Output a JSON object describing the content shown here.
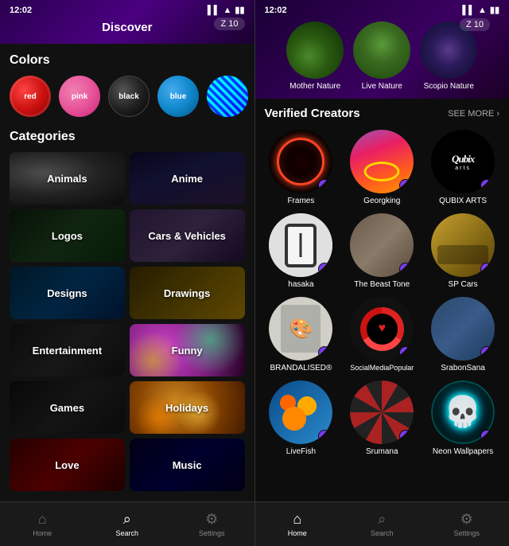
{
  "left": {
    "status": {
      "time": "12:02",
      "icons": "▌▌ ▲ ▮▮"
    },
    "header": {
      "title": "Discover",
      "badge": "Z 10"
    },
    "colors": {
      "section_title": "Colors",
      "items": [
        {
          "label": "red",
          "bg": "#cc1111"
        },
        {
          "label": "pink",
          "bg": "#e8559a"
        },
        {
          "label": "black",
          "bg": "#222222"
        },
        {
          "label": "blue",
          "bg": "#1188cc"
        }
      ]
    },
    "categories": {
      "section_title": "Categories",
      "items": [
        "Animals",
        "Anime",
        "Logos",
        "Cars & Vehicles",
        "Designs",
        "Drawings",
        "Entertainment",
        "Funny",
        "Games",
        "Holidays",
        "Love",
        "Music"
      ]
    },
    "nav": {
      "items": [
        {
          "label": "Home",
          "icon": "⌂",
          "active": false
        },
        {
          "label": "Search",
          "icon": "⌕",
          "active": true
        },
        {
          "label": "Settings",
          "icon": "⚙",
          "active": false
        }
      ]
    }
  },
  "right": {
    "status": {
      "time": "12:02",
      "icons": "▌▌ ▲ ▮▮"
    },
    "nature_items": [
      {
        "label": "Mother Nature"
      },
      {
        "label": "Live Nature"
      },
      {
        "label": "Scopio Nature"
      }
    ],
    "badge": "Z 10",
    "verified": {
      "title": "Verified Creators",
      "see_more": "SEE MORE ›",
      "creators": [
        {
          "name": "Frames",
          "type": "frames"
        },
        {
          "name": "Georgking",
          "type": "georg"
        },
        {
          "name": "QUBIX ARTS",
          "type": "qubix"
        },
        {
          "name": "hasaka",
          "type": "hasaka"
        },
        {
          "name": "The Beast Tone",
          "type": "beast"
        },
        {
          "name": "SP Cars",
          "type": "sp"
        },
        {
          "name": "BRANDALISED®",
          "type": "brand"
        },
        {
          "name": "SocialMediaPopular",
          "type": "social"
        },
        {
          "name": "SrabonSana",
          "type": "srabon"
        },
        {
          "name": "LiveFish",
          "type": "livefish"
        },
        {
          "name": "Srumana",
          "type": "srumana"
        },
        {
          "name": "Neon Wallpapers",
          "type": "neon"
        }
      ]
    },
    "nav": {
      "items": [
        {
          "label": "Home",
          "icon": "⌂",
          "active": true
        },
        {
          "label": "Search",
          "icon": "⌕",
          "active": false
        },
        {
          "label": "Settings",
          "icon": "⚙",
          "active": false
        }
      ]
    }
  }
}
